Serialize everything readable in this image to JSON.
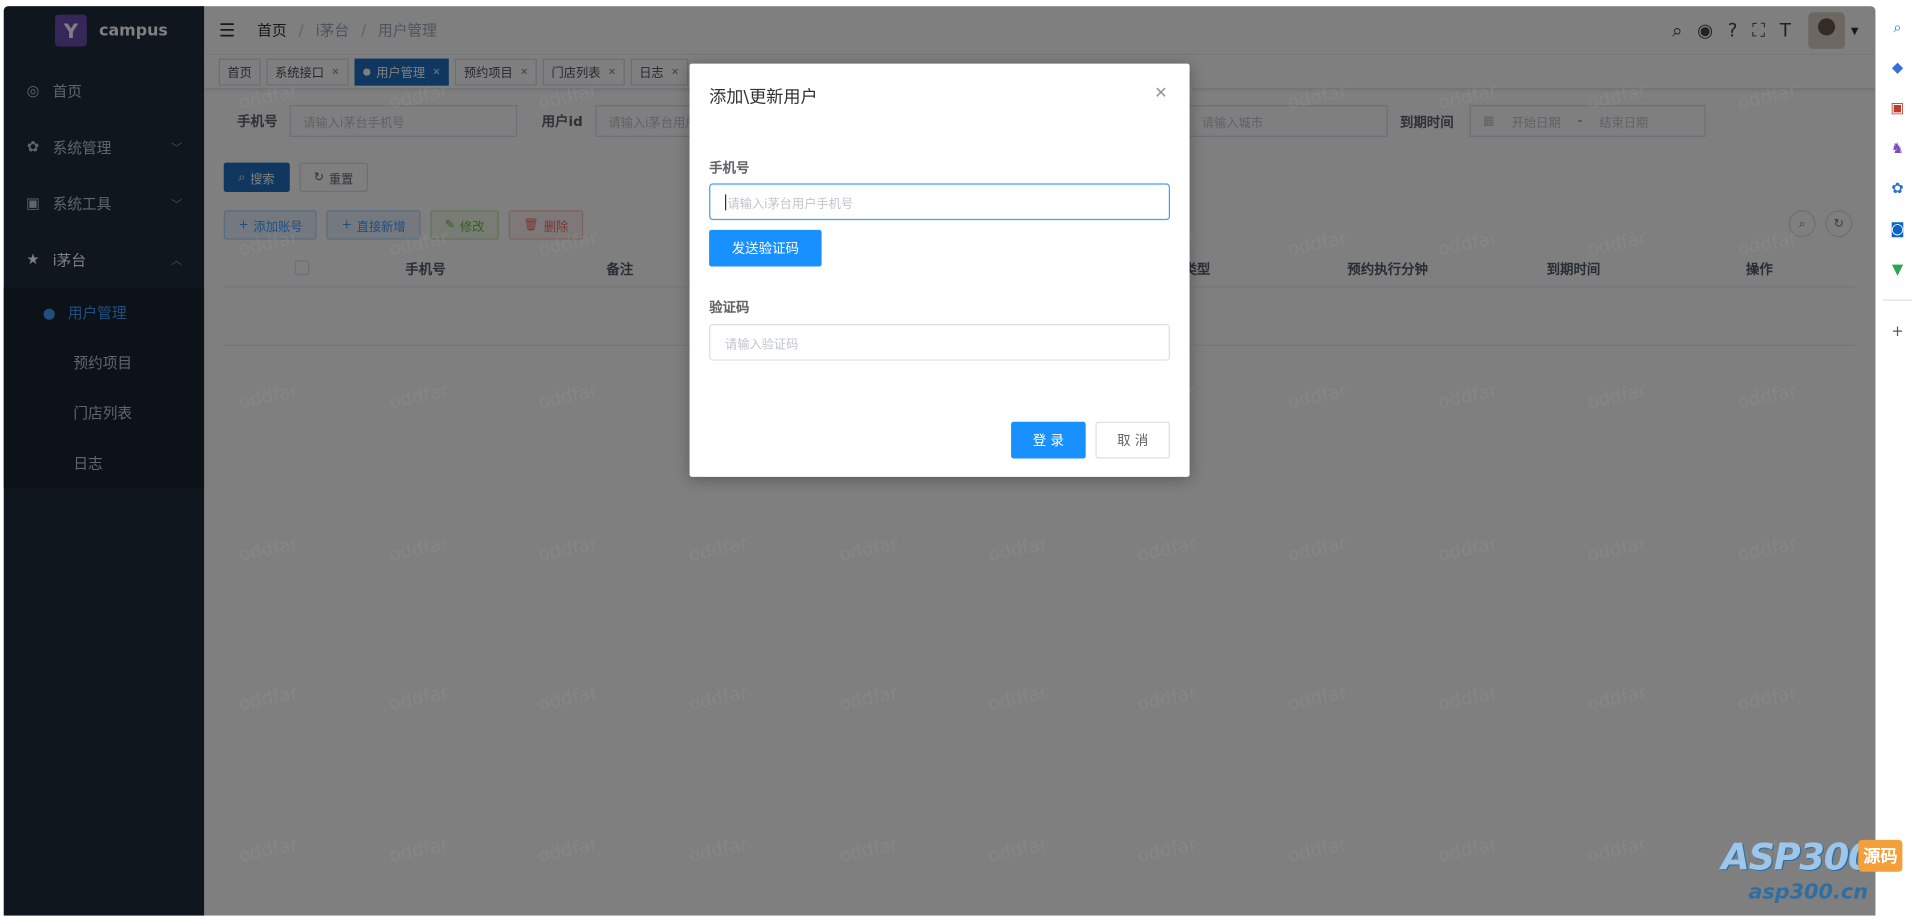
{
  "brand": {
    "logo_letter": "Y",
    "name": "campus"
  },
  "sidebar": {
    "items": [
      {
        "icon": "dashboard-icon",
        "glyph": "◎",
        "label": "首页"
      },
      {
        "icon": "gear-icon",
        "glyph": "✿",
        "label": "系统管理"
      },
      {
        "icon": "toolbox-icon",
        "glyph": "▣",
        "label": "系统工具"
      },
      {
        "icon": "star-icon",
        "glyph": "★",
        "label": "i茅台"
      }
    ],
    "sub_items": [
      {
        "icon": "user-icon",
        "glyph": "●",
        "label": "用户管理",
        "active": true
      },
      {
        "label": "预约项目"
      },
      {
        "label": "门店列表"
      },
      {
        "label": "日志"
      }
    ]
  },
  "navbar": {
    "breadcrumb": [
      "首页",
      "i茅台",
      "用户管理"
    ],
    "separator": "/"
  },
  "tags": [
    {
      "label": "首页",
      "active": false,
      "closable": false
    },
    {
      "label": "系统接口",
      "active": false,
      "closable": true
    },
    {
      "label": "用户管理",
      "active": true,
      "closable": true
    },
    {
      "label": "预约项目",
      "active": false,
      "closable": true
    },
    {
      "label": "门店列表",
      "active": false,
      "closable": true
    },
    {
      "label": "日志",
      "active": false,
      "closable": true
    }
  ],
  "filters": {
    "phone_label": "手机号",
    "phone_placeholder": "请输入i茅台手机号",
    "userid_label": "用户id",
    "userid_placeholder": "请输入i茅台用户",
    "city_placeholder": "请输入城市",
    "expire_label": "到期时间",
    "start_placeholder": "开始日期",
    "range_sep": "-",
    "end_placeholder": "结束日期"
  },
  "actions": {
    "search": "搜索",
    "reset": "重置",
    "add_account": "添加账号",
    "direct_add": "直接新增",
    "edit": "修改",
    "delete": "删除"
  },
  "table": {
    "columns": [
      "手机号",
      "备注",
      "类型",
      "预约执行分钟",
      "到期时间",
      "操作"
    ]
  },
  "dialog": {
    "title": "添加\\更新用户",
    "phone_label": "手机号",
    "phone_placeholder": "请输入i茅台用户手机号",
    "send_code": "发送验证码",
    "code_label": "验证码",
    "code_placeholder": "请输入验证码",
    "login": "登 录",
    "cancel": "取 消"
  },
  "watermark": "oddfar",
  "badge": {
    "main": "ASP300",
    "tag": "源码",
    "domain": "asp300.cn"
  },
  "colors": {
    "primary": "#1e6fbf",
    "dialog_primary": "#1890ff",
    "sidebar_bg": "#1f2d3d"
  }
}
